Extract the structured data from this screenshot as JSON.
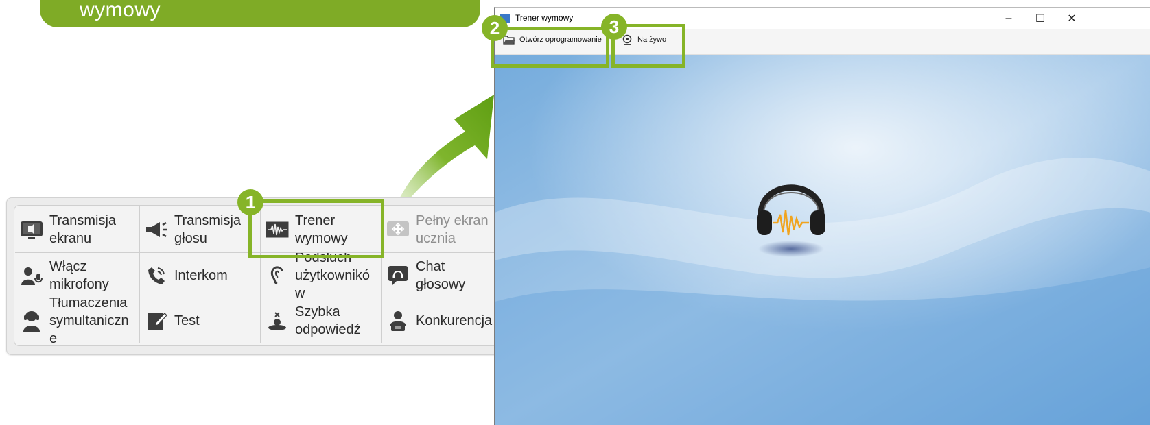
{
  "banner": {
    "text": "wymowy"
  },
  "panel": {
    "items": [
      {
        "label_1": "Transmisja",
        "label_2": "ekranu",
        "icon": "screen-transmission-icon"
      },
      {
        "label_1": "Transmisja",
        "label_2": "głosu",
        "icon": "megaphone-icon"
      },
      {
        "label_1": "Trener",
        "label_2": "wymowy",
        "icon": "waveform-icon"
      },
      {
        "label_1": "Pełny ekran",
        "label_2": "ucznia",
        "icon": "fullscreen-icon"
      },
      {
        "label_1": "Włącz",
        "label_2": "mikrofony",
        "icon": "users-mic-icon"
      },
      {
        "label_1": "Interkom",
        "icon": "phone-icon"
      },
      {
        "label_1": "Podsłuch",
        "label_2": "użytkownikó",
        "label_3": "w",
        "icon": "ear-icon"
      },
      {
        "label_1": "Chat",
        "label_2": "głosowy",
        "icon": "voice-chat-icon"
      },
      {
        "label_1": "Tłumaczenia",
        "label_2": "symultaniczn",
        "label_3": "e",
        "icon": "interpreter-icon"
      },
      {
        "label_1": "Test",
        "icon": "test-icon"
      },
      {
        "label_1": "Szybka",
        "label_2": "odpowiedź",
        "icon": "quick-answer-icon"
      },
      {
        "label_1": "Konkurencja",
        "icon": "competition-icon"
      }
    ]
  },
  "badges": {
    "one": "1",
    "two": "2",
    "three": "3"
  },
  "window": {
    "title": "Trener wymowy",
    "minimize": "–",
    "maximize": "☐",
    "close": "✕",
    "toolbar": {
      "open_software": "Otwórz oprogramowanie",
      "live": "Na żywo"
    }
  },
  "colors": {
    "accent_green": "#86b428",
    "banner_green": "#7fab26",
    "desktop_blue": "#7fb0de"
  }
}
